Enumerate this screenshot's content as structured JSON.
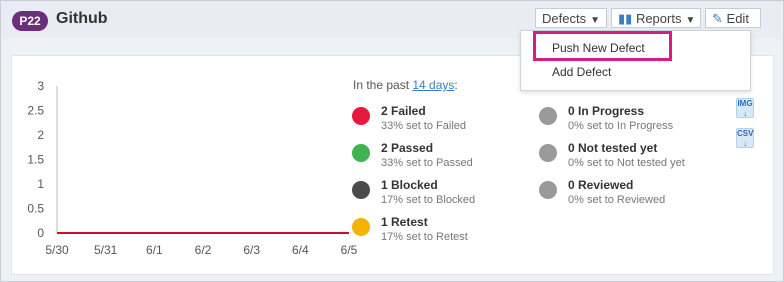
{
  "project": {
    "badge": "P22",
    "title": "Github"
  },
  "toolbar": {
    "defects_label": "Defects",
    "reports_label": "Reports",
    "edit_label": "Edit"
  },
  "dropdown": {
    "items": [
      "Push New Defect",
      "Add Defect"
    ]
  },
  "summary": {
    "prefix": "In the past ",
    "link": "14 days",
    "suffix": ":"
  },
  "stats": [
    {
      "main": "2 Failed",
      "sub": "33% set to Failed",
      "color": "#e8173f"
    },
    {
      "main": "2 Passed",
      "sub": "33% set to Passed",
      "color": "#3fb34f"
    },
    {
      "main": "1 Blocked",
      "sub": "17% set to Blocked",
      "color": "#4b4b4b"
    },
    {
      "main": "1 Retest",
      "sub": "17% set to Retest",
      "color": "#f2b400"
    },
    {
      "main": "0 In Progress",
      "sub": "0% set to In Progress",
      "color": "#9a9a9a"
    },
    {
      "main": "0 Not tested yet",
      "sub": "0% set to Not tested yet",
      "color": "#9a9a9a"
    },
    {
      "main": "0 Reviewed",
      "sub": "0% set to Reviewed",
      "color": "#9a9a9a"
    }
  ],
  "side_icons": {
    "image_label": "IMG",
    "csv_label": "CSV"
  },
  "chart_data": {
    "type": "line",
    "x": [
      "5/30",
      "5/31",
      "6/1",
      "6/2",
      "6/3",
      "6/4",
      "6/5"
    ],
    "y_ticks": [
      "0",
      "0.5",
      "1",
      "1.5",
      "2",
      "2.5",
      "3"
    ],
    "ylim": [
      0,
      3
    ],
    "series": [
      {
        "values": [
          0,
          0,
          0,
          0,
          0,
          0,
          0
        ],
        "color": "#c8102e"
      }
    ]
  }
}
